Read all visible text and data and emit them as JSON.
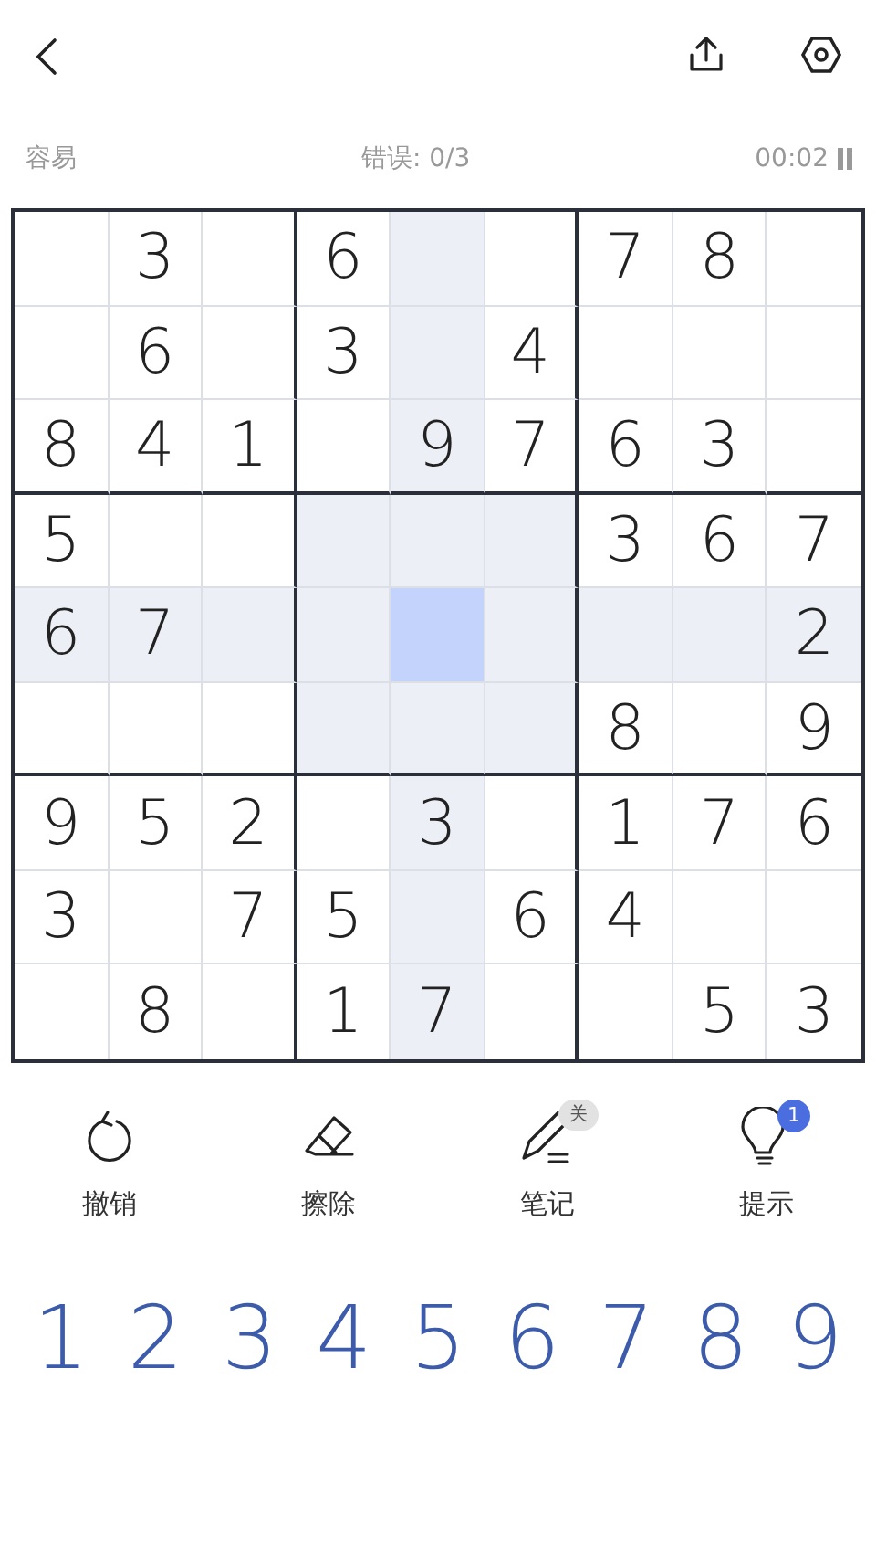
{
  "status": {
    "difficulty": "容易",
    "mistakes": "错误: 0/3",
    "timer": "00:02"
  },
  "board": {
    "rows": [
      [
        {
          "selected": false
        },
        {
          "digit": "3",
          "selected": false
        },
        {
          "selected": false
        },
        {
          "digit": "6",
          "selected": false
        },
        {
          "selected": false
        },
        {
          "selected": false
        },
        {
          "digit": "7",
          "selected": false
        },
        {
          "digit": "8",
          "selected": false
        },
        {
          "selected": false
        }
      ],
      [
        {
          "selected": false
        },
        {
          "digit": "6",
          "selected": false
        },
        {
          "selected": false
        },
        {
          "digit": "3",
          "selected": false
        },
        {
          "selected": false
        },
        {
          "digit": "4",
          "selected": false
        },
        {
          "selected": false
        },
        {
          "selected": false
        },
        {
          "selected": false
        }
      ],
      [
        {
          "digit": "8",
          "selected": false
        },
        {
          "digit": "4",
          "selected": false
        },
        {
          "digit": "1",
          "selected": false
        },
        {
          "selected": false
        },
        {
          "digit": "9",
          "selected": false
        },
        {
          "digit": "7",
          "selected": false
        },
        {
          "digit": "6",
          "selected": false
        },
        {
          "digit": "3",
          "selected": false
        },
        {
          "selected": false
        }
      ],
      [
        {
          "digit": "5",
          "selected": false
        },
        {
          "selected": false
        },
        {
          "selected": false
        },
        {
          "selected": false
        },
        {
          "selected": false
        },
        {
          "selected": false
        },
        {
          "digit": "3",
          "selected": false
        },
        {
          "digit": "6",
          "selected": false
        },
        {
          "digit": "7",
          "selected": false
        }
      ],
      [
        {
          "digit": "6",
          "selected": false
        },
        {
          "digit": "7",
          "selected": false
        },
        {
          "selected": false
        },
        {
          "selected": false
        },
        {
          "selected": true
        },
        {
          "selected": false
        },
        {
          "selected": false
        },
        {
          "selected": false
        },
        {
          "digit": "2",
          "selected": false
        }
      ],
      [
        {
          "selected": false
        },
        {
          "selected": false
        },
        {
          "selected": false
        },
        {
          "selected": false
        },
        {
          "selected": false
        },
        {
          "selected": false
        },
        {
          "digit": "8",
          "selected": false
        },
        {
          "selected": false
        },
        {
          "digit": "9",
          "selected": false
        }
      ],
      [
        {
          "digit": "9",
          "selected": false
        },
        {
          "digit": "5",
          "selected": false
        },
        {
          "digit": "2",
          "selected": false
        },
        {
          "selected": false
        },
        {
          "digit": "3",
          "selected": false
        },
        {
          "selected": false
        },
        {
          "digit": "1",
          "selected": false
        },
        {
          "digit": "7",
          "selected": false
        },
        {
          "digit": "6",
          "selected": false
        }
      ],
      [
        {
          "digit": "3",
          "selected": false
        },
        {
          "selected": false
        },
        {
          "digit": "7",
          "selected": false
        },
        {
          "digit": "5",
          "selected": false
        },
        {
          "selected": false
        },
        {
          "digit": "6",
          "selected": false
        },
        {
          "digit": "4",
          "selected": false
        },
        {
          "selected": false
        },
        {
          "selected": false
        }
      ],
      [
        {
          "selected": false
        },
        {
          "digit": "8",
          "selected": false
        },
        {
          "selected": false
        },
        {
          "digit": "1",
          "selected": false
        },
        {
          "digit": "7",
          "selected": false
        },
        {
          "selected": false
        },
        {
          "selected": false
        },
        {
          "digit": "5",
          "selected": false
        },
        {
          "digit": "3",
          "selected": false
        }
      ]
    ]
  },
  "tools": [
    {
      "kind": "undo",
      "label": "撤销"
    },
    {
      "kind": "erase",
      "label": "擦除"
    },
    {
      "kind": "notes",
      "label": "笔记",
      "badge": "关"
    },
    {
      "kind": "hint",
      "label": "提示",
      "count": "1"
    }
  ],
  "numpad": [
    "1",
    "2",
    "3",
    "4",
    "5",
    "6",
    "7",
    "8",
    "9"
  ]
}
